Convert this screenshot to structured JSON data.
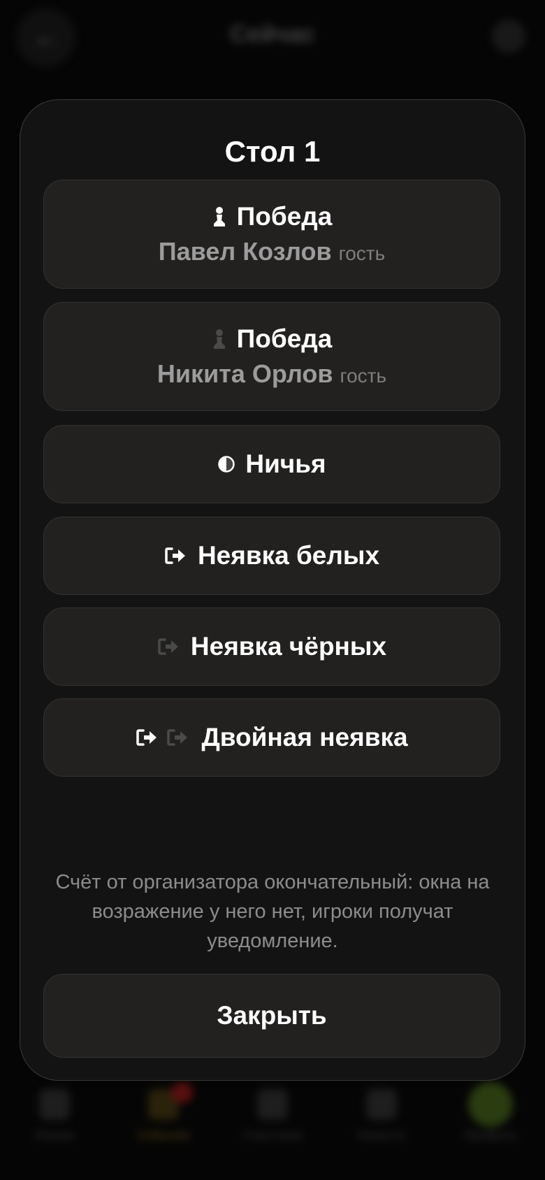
{
  "background": {
    "header_title": "Сейчас",
    "tabs": [
      {
        "label": "Игроки"
      },
      {
        "label": "События"
      },
      {
        "label": "Участники"
      },
      {
        "label": "Новости"
      },
      {
        "label": "Профиль"
      }
    ]
  },
  "modal": {
    "title": "Стол 1",
    "options": [
      {
        "label": "Победа",
        "player": "Павел Козлов",
        "tag": "гость",
        "icon": "pawn-white-icon"
      },
      {
        "label": "Победа",
        "player": "Никита Орлов",
        "tag": "гость",
        "icon": "pawn-black-icon"
      },
      {
        "label": "Ничья",
        "icon": "half-circle-icon"
      },
      {
        "label": "Неявка белых",
        "icon": "exit-white-icon"
      },
      {
        "label": "Неявка чёрных",
        "icon": "exit-black-icon"
      },
      {
        "label": "Двойная неявка",
        "icon": "exit-double-icon"
      }
    ],
    "note": "Счёт от организатора окончательный: окна на возражение у него нет, игроки получат уведомление.",
    "close_label": "Закрыть"
  },
  "colors": {
    "sheet_bg": "#131313",
    "option_bg": "#222120",
    "text_primary": "#ffffff",
    "text_secondary": "#9c9c9c"
  }
}
